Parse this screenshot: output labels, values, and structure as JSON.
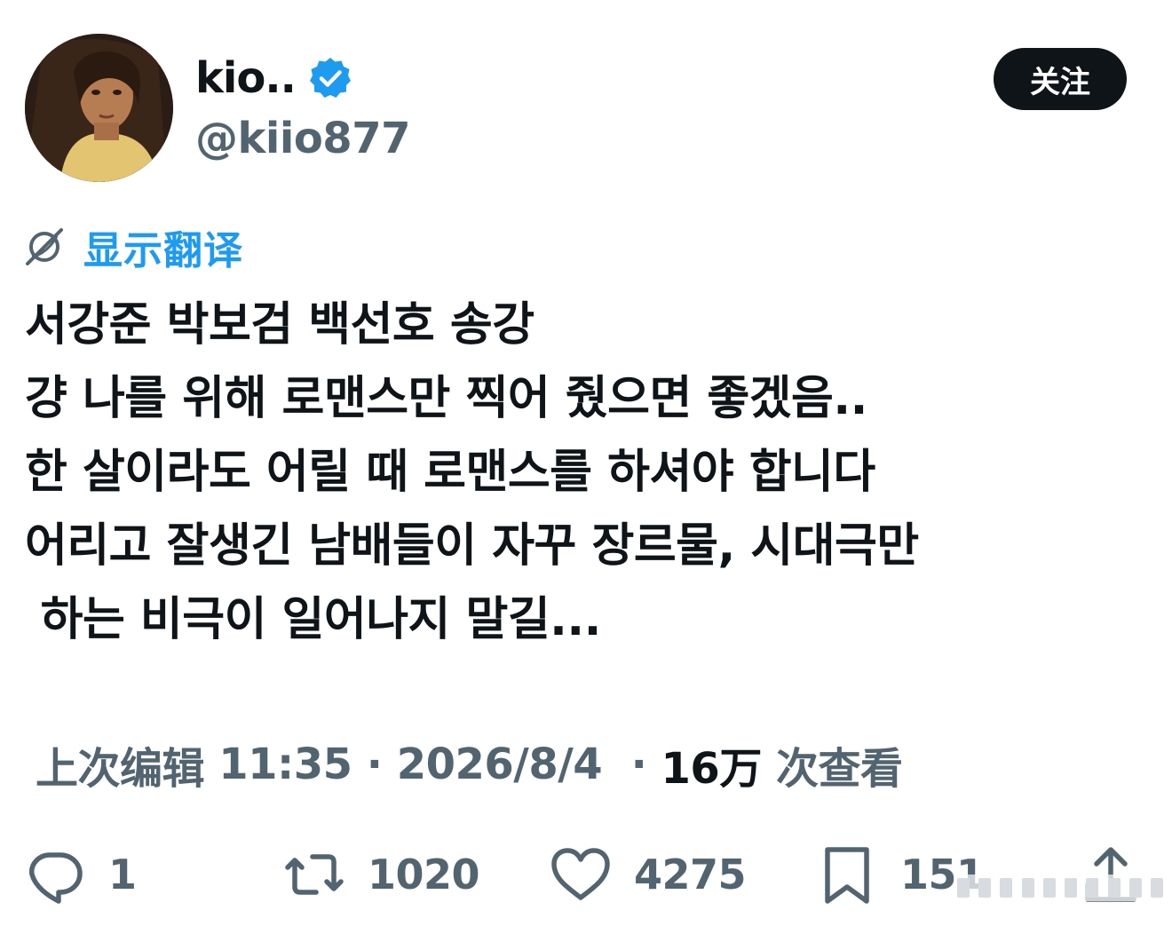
{
  "author": {
    "display_name": "kio..",
    "handle": "@kiio877",
    "verified": true,
    "avatar_icon": "profile-photo"
  },
  "follow_label": "关注",
  "translate": {
    "label": "显示翻译",
    "icon": "translate-globe-icon"
  },
  "tweet": {
    "lines": [
      "서강준 박보검 백선호 송강",
      "걍 나를 위해 로맨스만 찍어 줬으면 좋겠음..",
      "한 살이라도 어릴 때 로맨스를 하셔야 합니다",
      "어리고 잘생긴 남배들이 자꾸 장르물, 시대극만",
      " 하는 비극이 일어나지 말길..."
    ]
  },
  "meta": {
    "edited_label": "上次编辑",
    "time": "11:35",
    "separator": " · ",
    "date": "2026/8/4",
    "separator2": "  · ",
    "views_count": "16万",
    "views_label": " 次查看"
  },
  "actions": {
    "reply_count": "1",
    "retweet_count": "1020",
    "like_count": "4275",
    "bookmark_count": "151"
  },
  "colors": {
    "accent": "#1d9bf0",
    "text_primary": "#0f1419",
    "text_secondary": "#536471",
    "button_bg": "#0f1419"
  }
}
